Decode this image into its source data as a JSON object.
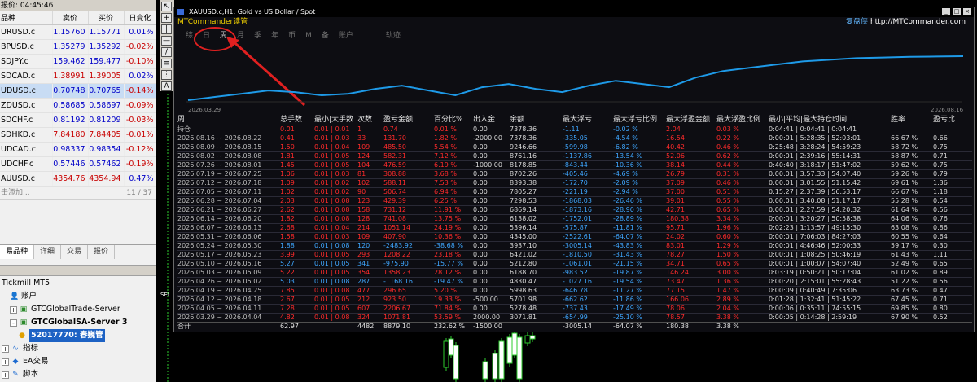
{
  "market_watch": {
    "title": "报价: 04:45:46",
    "columns": [
      "品种",
      "卖价",
      "买价",
      "日变化"
    ],
    "rows": [
      {
        "symbol": "URUSD.c",
        "bid": "1.15760",
        "ask": "1.15771",
        "change": "0.01%",
        "dir": "pos",
        "selected": false
      },
      {
        "symbol": "BPUSD.c",
        "bid": "1.35279",
        "ask": "1.35292",
        "change": "-0.02%",
        "dir": "neg",
        "selected": false
      },
      {
        "symbol": "SDJPY.c",
        "bid": "159.462",
        "ask": "159.477",
        "change": "-0.10%",
        "dir": "neg",
        "selected": false
      },
      {
        "symbol": "SDCAD.c",
        "bid": "1.38991",
        "ask": "1.39005",
        "change": "0.02%",
        "dir": "pos",
        "selected": false,
        "bidneg": true
      },
      {
        "symbol": "UDUSD.c",
        "bid": "0.70748",
        "ask": "0.70765",
        "change": "-0.14%",
        "dir": "neg",
        "selected": true
      },
      {
        "symbol": "ZDUSD.c",
        "bid": "0.58685",
        "ask": "0.58697",
        "change": "-0.09%",
        "dir": "neg",
        "selected": false
      },
      {
        "symbol": "SDCHF.c",
        "bid": "0.81192",
        "ask": "0.81209",
        "change": "-0.03%",
        "dir": "neg",
        "selected": false
      },
      {
        "symbol": "SDHKD.c",
        "bid": "7.84180",
        "ask": "7.84405",
        "change": "-0.01%",
        "dir": "neg",
        "selected": false,
        "bidneg": true
      },
      {
        "symbol": "UDCAD.c",
        "bid": "0.98337",
        "ask": "0.98354",
        "change": "-0.12%",
        "dir": "neg",
        "selected": false
      },
      {
        "symbol": "UDCHF.c",
        "bid": "0.57446",
        "ask": "0.57462",
        "change": "-0.19%",
        "dir": "neg",
        "selected": false
      },
      {
        "symbol": "AUUSD.c",
        "bid": "4354.76",
        "ask": "4354.94",
        "change": "0.47%",
        "dir": "pos",
        "selected": false,
        "bidneg": true
      }
    ],
    "add_label": "击添加...",
    "count": "11 / 37",
    "tabs": [
      "易品种",
      "详细",
      "交易",
      "报价"
    ]
  },
  "navigator": {
    "items": [
      {
        "label": "Tickmill MT5",
        "icon": "",
        "indent": 0
      },
      {
        "label": "账户",
        "icon": "account-icon",
        "indent": 1
      },
      {
        "label": "GTCGlobalTrade-Server",
        "icon": "server-icon",
        "indent": 1,
        "expander": "+"
      },
      {
        "label": "GTCGlobalSA-Server 3",
        "icon": "server-icon",
        "indent": 1,
        "expander": "-",
        "bold": true
      },
      {
        "label": "52017770: 春巍管",
        "icon": "user-icon",
        "indent": 2,
        "highlight": true
      },
      {
        "label": "指标",
        "icon": "indicator-icon",
        "indent": 0,
        "expander": "+"
      },
      {
        "label": "EA交易",
        "icon": "ea-icon",
        "indent": 0,
        "expander": "+"
      },
      {
        "label": "脚本",
        "icon": "script-icon",
        "indent": 0,
        "expander": "+"
      }
    ]
  },
  "report": {
    "window_title": "XAUUSD.c,H1:  Gold vs US Dollar / Spot",
    "brand": "MTCommander读管",
    "site_cn": "复盘侠",
    "site_url": "http://MTCommander.com",
    "tabs": [
      "综",
      "日",
      "周",
      "月",
      "季",
      "年",
      "币",
      "M",
      "备",
      "账户",
      "轨迹"
    ],
    "active_tab": "周",
    "date_start": "2026.03.29",
    "date_end": "2026.08.16",
    "headers": [
      "周",
      "总手数",
      "最小|大手数",
      "次数",
      "盈亏金额",
      "百分比%",
      "出入金",
      "余额",
      "最大浮亏",
      "最大浮亏比例",
      "最大浮盈金额",
      "最大浮盈比例",
      "最小|平均|最大持仓时间",
      "胜率",
      "盈亏比"
    ],
    "rows": [
      {
        "period": "持仓",
        "lots": "0.01",
        "minmax": "0.01 | 0.01",
        "count": "1",
        "pnl": "0.74",
        "pct": "0.01 %",
        "io": "0.00",
        "bal": "7378.36",
        "maxdd": "-1.11",
        "ddpct": "-0.02 %",
        "maxfp": "2.04",
        "fppct": "0.03 %",
        "hold": "0:04:41 | 0:04:41 | 0:04:41",
        "win": "",
        "pl": ""
      },
      {
        "period": "2026.08.16 ~ 2026.08.22",
        "lots": "0.41",
        "minmax": "0.01 | 0.03",
        "count": "33",
        "pnl": "131.70",
        "pct": "1.82 %",
        "io": "-2000.00",
        "bal": "7378.36",
        "maxdd": "-335.05",
        "ddpct": "-4.54 %",
        "maxfp": "16.54",
        "fppct": "0.22 %",
        "hold": "0:00:01 | 5:28:35 | 52:03:01",
        "win": "66.67 %",
        "pl": "0.66"
      },
      {
        "period": "2026.08.09 ~ 2026.08.15",
        "lots": "1.50",
        "minmax": "0.01 | 0.04",
        "count": "109",
        "pnl": "485.50",
        "pct": "5.54 %",
        "io": "0.00",
        "bal": "9246.66",
        "maxdd": "-599.98",
        "ddpct": "-6.82 %",
        "maxfp": "40.42",
        "fppct": "0.46 %",
        "hold": "0:25:48 | 3:28:24 | 54:59:23",
        "win": "58.72 %",
        "pl": "0.75"
      },
      {
        "period": "2026.08.02 ~ 2026.08.08",
        "lots": "1.81",
        "minmax": "0.01 | 0.05",
        "count": "124",
        "pnl": "582.31",
        "pct": "7.12 %",
        "io": "0.00",
        "bal": "8761.16",
        "maxdd": "-1137.86",
        "ddpct": "-13.54 %",
        "maxfp": "52.06",
        "fppct": "0.62 %",
        "hold": "0:00:01 | 2:39:16 | 55:14:31",
        "win": "58.87 %",
        "pl": "0.71"
      },
      {
        "period": "2026.07.26 ~ 2026.08.01",
        "lots": "1.45",
        "minmax": "0.01 | 0.05",
        "count": "104",
        "pnl": "476.59",
        "pct": "6.19 %",
        "io": "-1000.00",
        "bal": "8178.85",
        "maxdd": "-843.44",
        "ddpct": "-10.36 %",
        "maxfp": "38.14",
        "fppct": "0.44 %",
        "hold": "0:40:40 | 3:18:17 | 51:47:02",
        "win": "59.62 %",
        "pl": "0.75"
      },
      {
        "period": "2026.07.19 ~ 2026.07.25",
        "lots": "1.06",
        "minmax": "0.01 | 0.03",
        "count": "81",
        "pnl": "308.88",
        "pct": "3.68 %",
        "io": "0.00",
        "bal": "8702.26",
        "maxdd": "-405.46",
        "ddpct": "-4.69 %",
        "maxfp": "26.79",
        "fppct": "0.31 %",
        "hold": "0:00:01 | 3:57:33 | 54:07:40",
        "win": "59.26 %",
        "pl": "0.79"
      },
      {
        "period": "2026.07.12 ~ 2026.07.18",
        "lots": "1.09",
        "minmax": "0.01 | 0.02",
        "count": "102",
        "pnl": "588.11",
        "pct": "7.53 %",
        "io": "0.00",
        "bal": "8393.38",
        "maxdd": "-172.70",
        "ddpct": "-2.09 %",
        "maxfp": "37.09",
        "fppct": "0.46 %",
        "hold": "0:00:01 | 3:01:55 | 51:15:42",
        "win": "69.61 %",
        "pl": "1.36"
      },
      {
        "period": "2026.07.05 ~ 2026.07.11",
        "lots": "1.02",
        "minmax": "0.01 | 0.02",
        "count": "90",
        "pnl": "506.74",
        "pct": "6.94 %",
        "io": "0.00",
        "bal": "7805.27",
        "maxdd": "-221.19",
        "ddpct": "-2.94 %",
        "maxfp": "37.00",
        "fppct": "0.51 %",
        "hold": "0:15:27 | 2:37:39 | 56:53:17",
        "win": "66.67 %",
        "pl": "1.18"
      },
      {
        "period": "2026.06.28 ~ 2026.07.04",
        "lots": "2.03",
        "minmax": "0.01 | 0.08",
        "count": "123",
        "pnl": "429.39",
        "pct": "6.25 %",
        "io": "0.00",
        "bal": "7298.53",
        "maxdd": "-1868.03",
        "ddpct": "-26.46 %",
        "maxfp": "39.01",
        "fppct": "0.55 %",
        "hold": "0:00:01 | 3:40:08 | 51:17:17",
        "win": "55.28 %",
        "pl": "0.54"
      },
      {
        "period": "2026.06.21 ~ 2026.06.27",
        "lots": "2.62",
        "minmax": "0.01 | 0.08",
        "count": "158",
        "pnl": "731.12",
        "pct": "11.91 %",
        "io": "0.00",
        "bal": "6869.14",
        "maxdd": "-1873.16",
        "ddpct": "-28.90 %",
        "maxfp": "42.71",
        "fppct": "0.65 %",
        "hold": "0:00:01 | 2:27:59 | 54:20:32",
        "win": "61.64 %",
        "pl": "0.56"
      },
      {
        "period": "2026.06.14 ~ 2026.06.20",
        "lots": "1.82",
        "minmax": "0.01 | 0.08",
        "count": "128",
        "pnl": "741.08",
        "pct": "13.75 %",
        "io": "0.00",
        "bal": "6138.02",
        "maxdd": "-1752.01",
        "ddpct": "-28.89 %",
        "maxfp": "180.38",
        "fppct": "3.34 %",
        "hold": "0:00:01 | 3:20:27 | 50:58:38",
        "win": "64.06 %",
        "pl": "0.76"
      },
      {
        "period": "2026.06.07 ~ 2026.06.13",
        "lots": "2.68",
        "minmax": "0.01 | 0.04",
        "count": "214",
        "pnl": "1051.14",
        "pct": "24.19 %",
        "io": "0.00",
        "bal": "5396.14",
        "maxdd": "-575.87",
        "ddpct": "-11.81 %",
        "maxfp": "95.71",
        "fppct": "1.96 %",
        "hold": "0:02:23 | 1:13:57 | 49:15:30",
        "win": "63.08 %",
        "pl": "0.86"
      },
      {
        "period": "2026.05.31 ~ 2026.06.06",
        "lots": "1.58",
        "minmax": "0.01 | 0.03",
        "count": "109",
        "pnl": "407.90",
        "pct": "10.36 %",
        "io": "0.00",
        "bal": "4345.00",
        "maxdd": "-2522.61",
        "ddpct": "-64.07 %",
        "maxfp": "24.02",
        "fppct": "0.60 %",
        "hold": "0:00:01 | 7:06:03 | 84:27:03",
        "win": "60.55 %",
        "pl": "0.64"
      },
      {
        "period": "2026.05.24 ~ 2026.05.30",
        "lots": "1.88",
        "minmax": "0.01 | 0.08",
        "count": "120",
        "pnl": "-2483.92",
        "pct": "-38.68 %",
        "io": "0.00",
        "bal": "3937.10",
        "maxdd": "-3005.14",
        "ddpct": "-43.83 %",
        "maxfp": "83.01",
        "fppct": "1.29 %",
        "hold": "0:00:01 | 4:46:46 | 52:00:33",
        "win": "59.17 %",
        "pl": "0.30"
      },
      {
        "period": "2026.05.17 ~ 2026.05.23",
        "lots": "3.99",
        "minmax": "0.01 | 0.05",
        "count": "293",
        "pnl": "1208.22",
        "pct": "23.18 %",
        "io": "0.00",
        "bal": "6421.02",
        "maxdd": "-1810.50",
        "ddpct": "-31.43 %",
        "maxfp": "78.27",
        "fppct": "1.50 %",
        "hold": "0:00:01 | 1:08:25 | 50:46:19",
        "win": "61.43 %",
        "pl": "1.11"
      },
      {
        "period": "2026.05.10 ~ 2026.05.16",
        "lots": "5.27",
        "minmax": "0.01 | 0.05",
        "count": "341",
        "pnl": "-975.90",
        "pct": "-15.77 %",
        "io": "0.00",
        "bal": "5212.80",
        "maxdd": "-1061.01",
        "ddpct": "-21.15 %",
        "maxfp": "34.71",
        "fppct": "0.65 %",
        "hold": "0:00:01 | 1:00:07 | 54:07:40",
        "win": "52.49 %",
        "pl": "0.65"
      },
      {
        "period": "2026.05.03 ~ 2026.05.09",
        "lots": "5.22",
        "minmax": "0.01 | 0.05",
        "count": "354",
        "pnl": "1358.23",
        "pct": "28.12 %",
        "io": "0.00",
        "bal": "6188.70",
        "maxdd": "-983.52",
        "ddpct": "-19.87 %",
        "maxfp": "146.24",
        "fppct": "3.00 %",
        "hold": "0:03:19 | 0:50:21 | 50:17:04",
        "win": "61.02 %",
        "pl": "0.89"
      },
      {
        "period": "2026.04.26 ~ 2026.05.02",
        "lots": "5.03",
        "minmax": "0.01 | 0.08",
        "count": "287",
        "pnl": "-1168.16",
        "pct": "-19.47 %",
        "io": "0.00",
        "bal": "4830.47",
        "maxdd": "-1027.16",
        "ddpct": "-19.54 %",
        "maxfp": "73.47",
        "fppct": "1.36 %",
        "hold": "0:00:20 | 2:15:01 | 55:28:43",
        "win": "51.22 %",
        "pl": "0.56"
      },
      {
        "period": "2026.04.19 ~ 2026.04.25",
        "lots": "7.85",
        "minmax": "0.01 | 0.08",
        "count": "477",
        "pnl": "296.65",
        "pct": "5.20 %",
        "io": "0.00",
        "bal": "5998.63",
        "maxdd": "-646.78",
        "ddpct": "-11.27 %",
        "maxfp": "77.15",
        "fppct": "1.47 %",
        "hold": "0:00:09 | 0:40:49 | 7:35:06",
        "win": "63.73 %",
        "pl": "0.47"
      },
      {
        "period": "2026.04.12 ~ 2026.04.18",
        "lots": "2.67",
        "minmax": "0.01 | 0.05",
        "count": "212",
        "pnl": "923.50",
        "pct": "19.33 %",
        "io": "-500.00",
        "bal": "5701.98",
        "maxdd": "-662.62",
        "ddpct": "-11.86 %",
        "maxfp": "166.06",
        "fppct": "2.89 %",
        "hold": "0:01:28 | 1:32:41 | 51:45:22",
        "win": "67.45 %",
        "pl": "0.71"
      },
      {
        "period": "2026.04.05 ~ 2026.04.11",
        "lots": "7.28",
        "minmax": "0.01 | 0.05",
        "count": "607",
        "pnl": "2206.67",
        "pct": "71.84 %",
        "io": "0.00",
        "bal": "5278.48",
        "maxdd": "-737.43",
        "ddpct": "-17.49 %",
        "maxfp": "78.06",
        "fppct": "2.04 %",
        "hold": "0:00:06 | 0:35:11 | 74:55:15",
        "win": "69.85 %",
        "pl": "0.80"
      },
      {
        "period": "2026.03.29 ~ 2026.04.04",
        "lots": "4.82",
        "minmax": "0.01 | 0.08",
        "count": "324",
        "pnl": "1071.81",
        "pct": "53.59 %",
        "io": "2000.00",
        "bal": "3071.81",
        "maxdd": "-654.99",
        "ddpct": "-25.10 %",
        "maxfp": "78.57",
        "fppct": "3.38 %",
        "hold": "0:00:05 | 0:14:28 | 2:59:19",
        "win": "67.90 %",
        "pl": "0.52"
      }
    ],
    "total": {
      "period": "合计",
      "lots": "62.97",
      "minmax": "",
      "count": "4482",
      "pnl": "8879.10",
      "pct": "232.62 %",
      "io": "-1500.00",
      "bal": "",
      "maxdd": "-3005.14",
      "ddpct": "-64.07 %",
      "maxfp": "180.38",
      "fppct": "3.38 %",
      "hold": "",
      "win": "",
      "pl": ""
    },
    "curve": [
      30,
      28,
      26,
      24,
      25,
      27,
      26,
      23,
      21,
      24,
      27,
      22,
      20,
      23,
      25,
      21,
      18,
      20,
      22,
      16,
      12,
      10,
      8,
      6,
      5,
      4,
      3.6,
      3.2,
      3,
      2.8
    ]
  },
  "colors": {
    "up": "#3fa7ff",
    "down": "#ff2b2b",
    "brand": "#f0d000",
    "curve": "#1e9ae8"
  }
}
